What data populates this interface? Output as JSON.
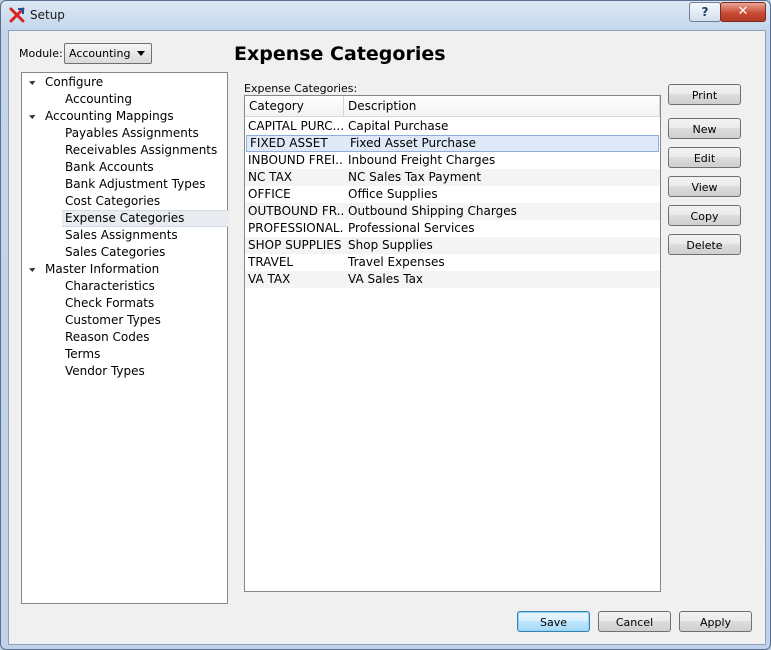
{
  "window": {
    "title": "Setup",
    "help_label": "?",
    "close_label": "✕"
  },
  "module": {
    "label": "Module:",
    "value": "Accounting"
  },
  "tree": [
    {
      "label": "Configure",
      "level": 0
    },
    {
      "label": "Accounting",
      "level": 1
    },
    {
      "label": "Accounting Mappings",
      "level": 0
    },
    {
      "label": "Payables Assignments",
      "level": 1
    },
    {
      "label": "Receivables Assignments",
      "level": 1
    },
    {
      "label": "Bank Accounts",
      "level": 1
    },
    {
      "label": "Bank Adjustment Types",
      "level": 1
    },
    {
      "label": "Cost Categories",
      "level": 1
    },
    {
      "label": "Expense Categories",
      "level": 1,
      "selected": true
    },
    {
      "label": "Sales Assignments",
      "level": 1
    },
    {
      "label": "Sales Categories",
      "level": 1
    },
    {
      "label": "Master Information",
      "level": 0
    },
    {
      "label": "Characteristics",
      "level": 1
    },
    {
      "label": "Check Formats",
      "level": 1
    },
    {
      "label": "Customer Types",
      "level": 1
    },
    {
      "label": "Reason Codes",
      "level": 1
    },
    {
      "label": "Terms",
      "level": 1
    },
    {
      "label": "Vendor Types",
      "level": 1
    }
  ],
  "page": {
    "title": "Expense Categories",
    "list_caption": "Expense Categories:"
  },
  "table": {
    "columns": [
      "Category",
      "Description"
    ],
    "rows": [
      [
        "CAPITAL PURC...",
        "Capital Purchase"
      ],
      [
        "FIXED ASSET",
        "Fixed Asset Purchase"
      ],
      [
        "INBOUND FREI...",
        "Inbound Freight Charges"
      ],
      [
        "NC TAX",
        "NC Sales Tax Payment"
      ],
      [
        "OFFICE",
        "Office Supplies"
      ],
      [
        "OUTBOUND FR...",
        "Outbound Shipping Charges"
      ],
      [
        "PROFESSIONAL...",
        "Professional Services"
      ],
      [
        "SHOP SUPPLIES",
        "Shop Supplies"
      ],
      [
        "TRAVEL",
        "Travel Expenses"
      ],
      [
        "VA TAX",
        "VA Sales Tax"
      ]
    ],
    "selected_row": 1
  },
  "side_buttons": {
    "print": "Print",
    "new": "New",
    "edit": "Edit",
    "view": "View",
    "copy": "Copy",
    "delete": "Delete"
  },
  "footer_buttons": {
    "save": "Save",
    "cancel": "Cancel",
    "apply": "Apply"
  },
  "colors": {
    "accent": "#3c7fb1",
    "close": "#c94b34",
    "selection": "#dfe9f7"
  }
}
